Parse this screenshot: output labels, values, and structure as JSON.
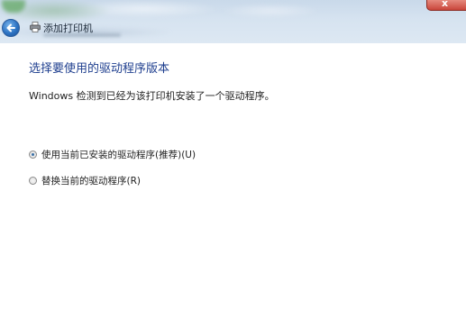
{
  "window": {
    "title": "添加打印机",
    "close_glyph": "x",
    "icons": {
      "back": "back-arrow-icon",
      "printer": "printer-icon"
    }
  },
  "content": {
    "heading": "选择要使用的驱动程序版本",
    "description": "Windows 检测到已经为该打印机安装了一个驱动程序。",
    "options": [
      {
        "label": "使用当前已安装的驱动程序(推荐)(U)",
        "selected": true
      },
      {
        "label": "替换当前的驱动程序(R)",
        "selected": false
      }
    ]
  },
  "colors": {
    "heading": "#1f3f8f",
    "accent": "#2d73c3",
    "close": "#c9453a"
  }
}
